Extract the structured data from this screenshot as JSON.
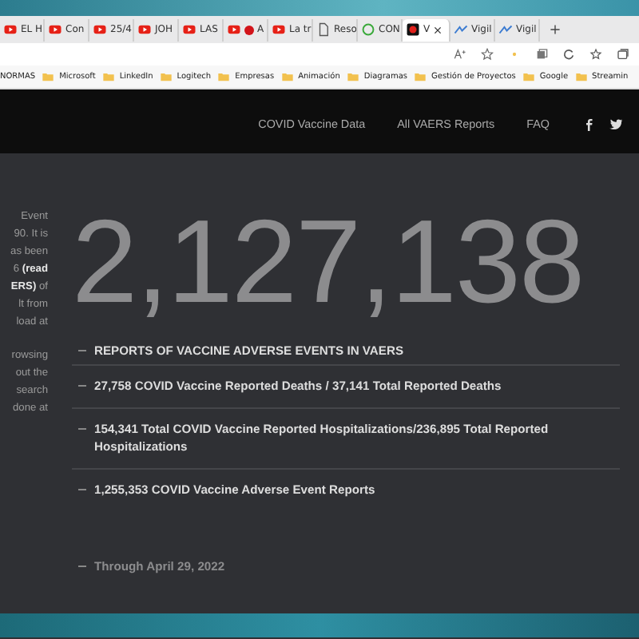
{
  "browser": {
    "tabs": [
      {
        "label": "EL H",
        "kind": "youtube",
        "selected": false
      },
      {
        "label": "Con",
        "kind": "youtube",
        "selected": false
      },
      {
        "label": "25/4",
        "kind": "youtube",
        "selected": false
      },
      {
        "label": "JOH",
        "kind": "youtube",
        "selected": false
      },
      {
        "label": "LAS",
        "kind": "youtube",
        "selected": false
      },
      {
        "label": "A",
        "kind": "dot",
        "selected": false
      },
      {
        "label": "La tr",
        "kind": "youtube",
        "selected": false
      },
      {
        "label": "Reso",
        "kind": "page",
        "selected": false
      },
      {
        "label": "CON",
        "kind": "chat",
        "selected": false
      },
      {
        "label": "V",
        "kind": "record",
        "selected": true
      },
      {
        "label": "Vigil",
        "kind": "vigil",
        "selected": false
      },
      {
        "label": "Vigil",
        "kind": "vigil",
        "selected": false
      }
    ],
    "bookmarks": [
      {
        "label": "NORMAS",
        "kind": "text"
      },
      {
        "label": "Microsoft",
        "kind": "folder"
      },
      {
        "label": "LinkedIn",
        "kind": "folder"
      },
      {
        "label": "Logitech",
        "kind": "folder"
      },
      {
        "label": "Empresas",
        "kind": "folder"
      },
      {
        "label": "Animación",
        "kind": "folder"
      },
      {
        "label": "Diagramas",
        "kind": "folder"
      },
      {
        "label": "Gestión de Proyectos",
        "kind": "folder"
      },
      {
        "label": "Google",
        "kind": "folder"
      },
      {
        "label": "Streamin",
        "kind": "folder"
      }
    ]
  },
  "site": {
    "nav": [
      "COVID Vaccine Data",
      "All VAERS Reports",
      "FAQ"
    ],
    "social": [
      {
        "kind": "facebook"
      },
      {
        "kind": "twitter"
      }
    ]
  },
  "intro_paragraphs": [
    [
      "Event",
      "90. It is",
      "as been",
      "6 **(read**",
      "**ERS)** of",
      "lt from",
      "load at"
    ],
    [
      "rowsing",
      "out the",
      "search",
      "done at"
    ]
  ],
  "total": "2,127,138",
  "stats": [
    {
      "text": "REPORTS OF VACCINE ADVERSE EVENTS IN VAERS",
      "kind": "heading"
    },
    {
      "text": "27,758 COVID Vaccine Reported Deaths / 37,141 Total Reported Deaths",
      "kind": "item"
    },
    {
      "text": "154,341 Total COVID Vaccine Reported Hospitalizations/236,895 Total Reported Hospitalizations",
      "kind": "item"
    },
    {
      "text": "1,255,353 COVID Vaccine Adverse Event Reports",
      "kind": "item"
    },
    {
      "text": "Through April 29, 2022",
      "kind": "note"
    }
  ]
}
